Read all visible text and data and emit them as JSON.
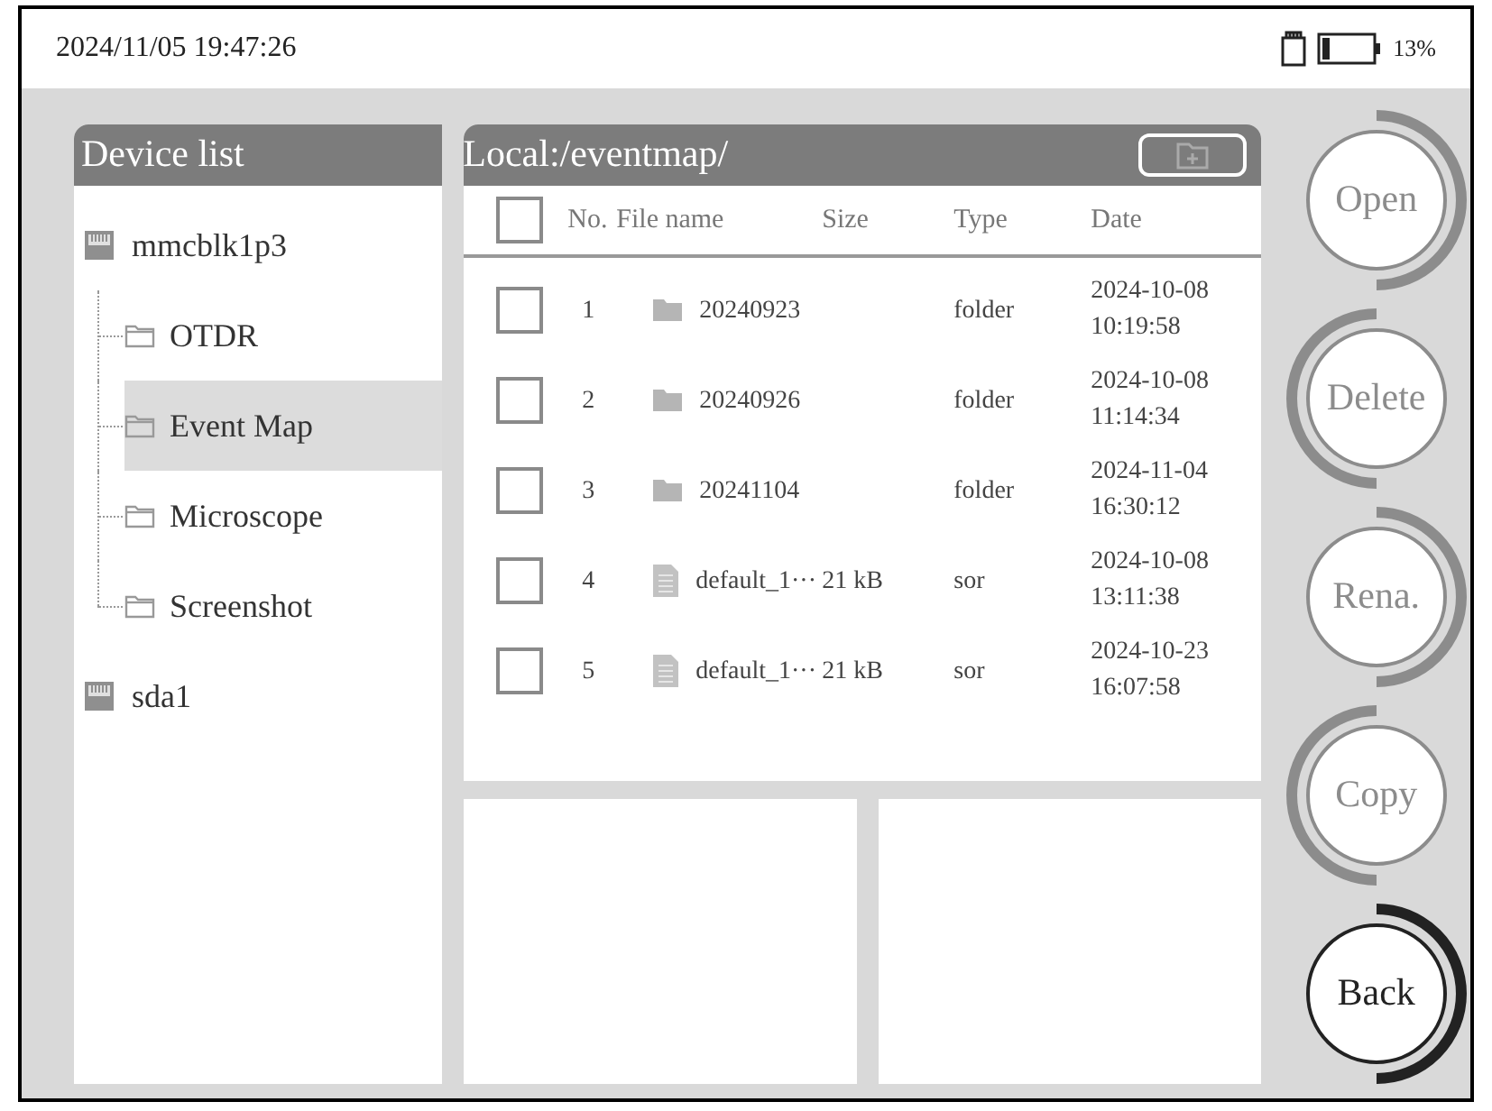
{
  "status_bar": {
    "datetime": "2024/11/05 19:47:26",
    "battery": "13%"
  },
  "device_list": {
    "title": "Device list",
    "devices": [
      {
        "name": "mmcblk1p3",
        "selected": false,
        "children": [
          {
            "name": "OTDR",
            "selected": false
          },
          {
            "name": "Event Map",
            "selected": true
          },
          {
            "name": "Microscope",
            "selected": false
          },
          {
            "name": "Screenshot",
            "selected": false
          }
        ]
      },
      {
        "name": "sda1",
        "selected": false
      }
    ]
  },
  "file_list": {
    "path": "Local:/eventmap/",
    "select_all_checked": false,
    "columns": [
      "No.",
      "File name",
      "Size",
      "Type",
      "Date"
    ],
    "rows": [
      {
        "no": "1",
        "kind": "folder",
        "name": "20240923",
        "type": "folder",
        "date": "2024-10-08",
        "time": "10:19:58",
        "checked": false
      },
      {
        "no": "2",
        "kind": "folder",
        "name": "20240926",
        "type": "folder",
        "date": "2024-10-08",
        "time": "11:14:34",
        "checked": false
      },
      {
        "no": "3",
        "kind": "folder",
        "name": "20241104",
        "type": "folder",
        "date": "2024-11-04",
        "time": "16:30:12",
        "checked": false
      },
      {
        "no": "4",
        "kind": "file",
        "name": "default_1···",
        "size": "21 kB",
        "type": "sor",
        "date": "2024-10-08",
        "time": "13:11:38",
        "checked": false
      },
      {
        "no": "5",
        "kind": "file",
        "name": "default_1···",
        "size": "21 kB",
        "type": "sor",
        "date": "2024-10-23",
        "time": "16:07:58",
        "checked": false
      }
    ]
  },
  "buttons": [
    {
      "label": "Open",
      "kind": "arc_right",
      "disabled": true
    },
    {
      "label": "Delete",
      "kind": "arc_left",
      "disabled": true
    },
    {
      "label": "Rena.",
      "kind": "arc_right",
      "disabled": true
    },
    {
      "label": "Copy",
      "kind": "arc_left",
      "disabled": true
    },
    {
      "label": "Back",
      "kind": "arc_right",
      "disabled": false
    }
  ]
}
